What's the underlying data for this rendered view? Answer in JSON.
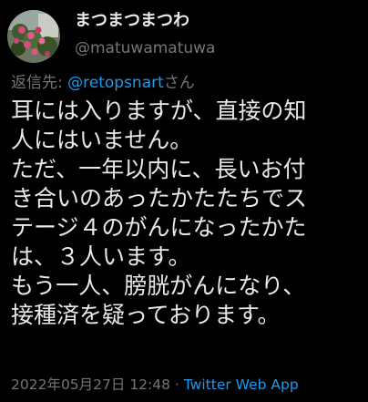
{
  "author": {
    "display_name": "まつまつまつわ",
    "handle": "@matuwamatuwa",
    "avatar_icon": "avatar-photo-flowers"
  },
  "reply": {
    "prefix": "返信先: ",
    "mention": "@retopsnart",
    "suffix": "さん"
  },
  "tweet": {
    "lines": [
      "耳には入りますが、直接の知",
      "人にはいません。",
      "ただ、一年以内に、長いお付",
      "き合いのあったかたたちでス",
      "テージ４のがんになったかた",
      "は、３人います。",
      "もう一人、膀胱がんになり、",
      "接種済を疑っております。"
    ]
  },
  "meta": {
    "timestamp": "2022年05月27日 12:48",
    "separator": " · ",
    "source": "Twitter Web App"
  },
  "colors": {
    "background": "#000000",
    "text_primary": "#e7e9ea",
    "text_secondary": "#71767b",
    "accent": "#1d9bf0"
  }
}
